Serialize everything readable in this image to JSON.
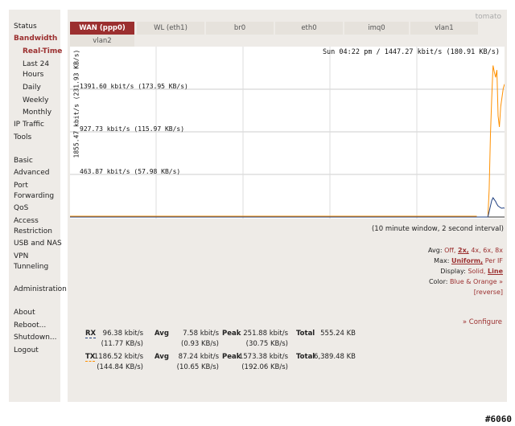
{
  "sidebar": {
    "items": [
      {
        "label": "Status"
      },
      {
        "label": "Bandwidth"
      },
      {
        "label": "Real-Time"
      },
      {
        "label": "Last 24"
      },
      {
        "label": "Hours"
      },
      {
        "label": "Daily"
      },
      {
        "label": "Weekly"
      },
      {
        "label": "Monthly"
      },
      {
        "label": "IP Traffic"
      },
      {
        "label": "Tools"
      },
      {
        "label": "Basic"
      },
      {
        "label": "Advanced"
      },
      {
        "label": "Port"
      },
      {
        "label": "Forwarding"
      },
      {
        "label": "QoS"
      },
      {
        "label": "Access"
      },
      {
        "label": "Restriction"
      },
      {
        "label": "USB and NAS"
      },
      {
        "label": "VPN"
      },
      {
        "label": "Tunneling"
      },
      {
        "label": "Administration"
      },
      {
        "label": "About"
      },
      {
        "label": "Reboot..."
      },
      {
        "label": "Shutdown..."
      },
      {
        "label": "Logout"
      }
    ]
  },
  "brand": "tomato",
  "tabs": [
    "WAN (ppp0)",
    "WL (eth1)",
    "br0",
    "eth0",
    "imq0",
    "vlan1",
    "vlan2"
  ],
  "graph": {
    "time_label": "Sun 04:22 pm / 1447.27 kbit/s (180.91 KB/s)",
    "ymax_label": "1855.47 kbit/s (231.93 KB/s)",
    "line_labels": [
      "1391.60 kbit/s (173.95 KB/s)",
      "927.73 kbit/s (115.97 KB/s)",
      "463.87 kbit/s (57.98 KB/s)"
    ]
  },
  "chart_data": {
    "type": "line",
    "title": "",
    "ylim": [
      0,
      1855.47
    ],
    "grid": true,
    "series": [
      {
        "name": "RX",
        "color": "#204080",
        "values": [
          0,
          0,
          0,
          0,
          0,
          0,
          0,
          0,
          0,
          0,
          60,
          120,
          180,
          210,
          190,
          170,
          140,
          120,
          110,
          100,
          95,
          100,
          96
        ]
      },
      {
        "name": "TX",
        "color": "#ff9000",
        "values": [
          0,
          0,
          0,
          0,
          0,
          0,
          0,
          0,
          0,
          0,
          300,
          900,
          1300,
          1650,
          1580,
          1520,
          1600,
          1100,
          980,
          1200,
          1300,
          1400,
          1447
        ]
      }
    ]
  },
  "window_note": "(10 minute window, 2 second interval)",
  "options": {
    "avg": {
      "label": "Avg:",
      "values": [
        "Off,",
        "2x,",
        "4x,",
        "6x,",
        "8x"
      ]
    },
    "max": {
      "label": "Max:",
      "values": [
        "Uniform,",
        "Per IF"
      ]
    },
    "display": {
      "label": "Display:",
      "values": [
        "Solid,",
        "Line"
      ]
    },
    "color": {
      "label": "Color:",
      "values": [
        "Blue & Orange »",
        "[reverse]"
      ]
    }
  },
  "configure": "» Configure",
  "stats": {
    "rx": {
      "key": "RX",
      "rate": "96.38 kbit/s",
      "rate_kb": "(11.77 KB/s)",
      "avg_label": "Avg",
      "avg": "7.58 kbit/s",
      "avg_kb": "(0.93 KB/s)",
      "peak_label": "Peak",
      "peak": "251.88 kbit/s",
      "peak_kb": "(30.75 KB/s)",
      "total_label": "Total",
      "total": "555.24 KB"
    },
    "tx": {
      "key": "TX",
      "rate": "1186.52 kbit/s",
      "rate_kb": "(144.84 KB/s)",
      "avg_label": "Avg",
      "avg": "87.24 kbit/s",
      "avg_kb": "(10.65 KB/s)",
      "peak_label": "Peak",
      "peak": "1573.38 kbit/s",
      "peak_kb": "(192.06 KB/s)",
      "total_label": "Total",
      "total": "6,389.48 KB"
    }
  },
  "watermark": "#6060"
}
